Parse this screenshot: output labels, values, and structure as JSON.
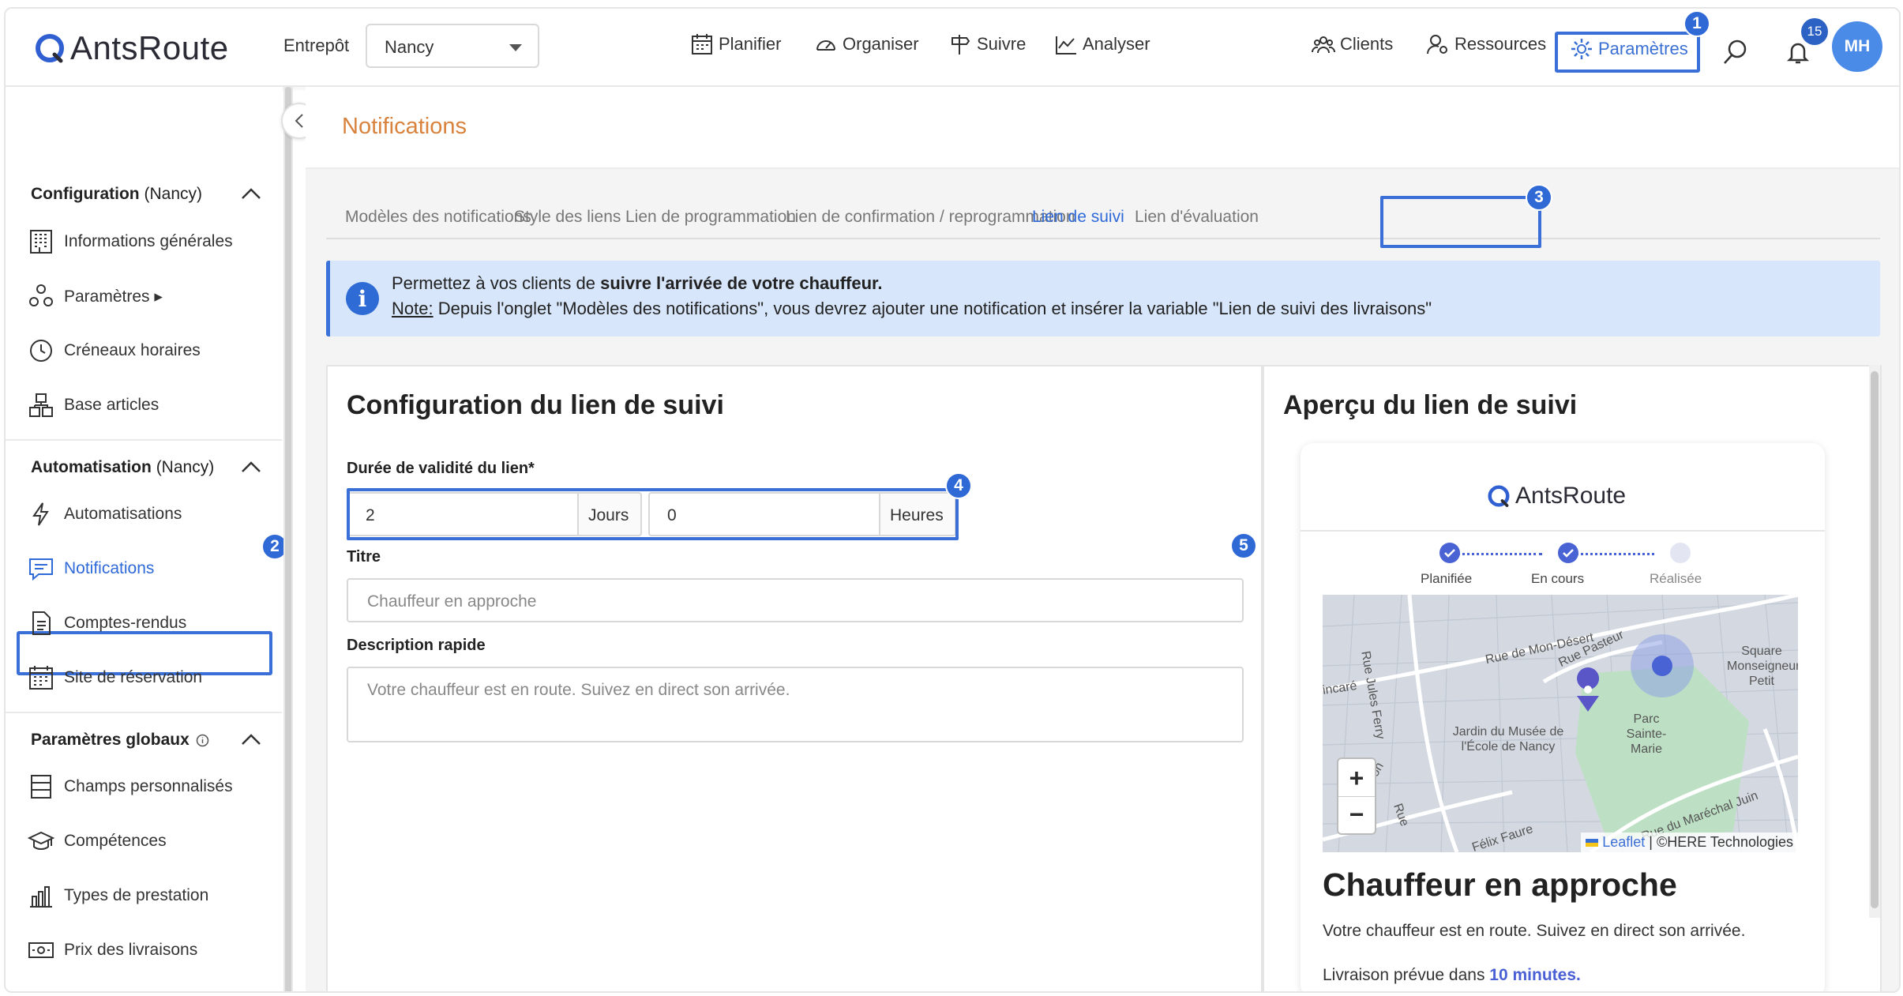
{
  "header": {
    "logo": "AntsRoute",
    "warehouse_label": "Entrepôt",
    "warehouse_value": "Nancy",
    "nav": [
      "Planifier",
      "Organiser",
      "Suivre",
      "Analyser"
    ],
    "right_nav": [
      "Clients",
      "Ressources",
      "Paramètres"
    ],
    "notification_count": "15",
    "avatar_initials": "MH"
  },
  "sidebar": {
    "section1": {
      "title": "Configuration",
      "scope": "(Nancy)"
    },
    "section1_items": [
      "Informations générales",
      "Paramètres ▸",
      "Créneaux horaires",
      "Base articles"
    ],
    "section2": {
      "title": "Automatisation",
      "scope": "(Nancy)"
    },
    "section2_items": [
      "Automatisations",
      "Notifications",
      "Comptes-rendus",
      "Site de réservation"
    ],
    "section3": {
      "title": "Paramètres globaux"
    },
    "section3_items": [
      "Champs personnalisés",
      "Compétences",
      "Types de prestation",
      "Prix des livraisons"
    ],
    "active_item": "Notifications"
  },
  "page": {
    "title": "Notifications",
    "tabs": [
      "Modèles des notifications",
      "Style des liens",
      "Lien de programmation",
      "Lien de confirmation / reprogrammation",
      "Lien de suivi",
      "Lien d'évaluation"
    ],
    "active_tab": "Lien de suivi",
    "info": {
      "line1_prefix": "Permettez à vos clients de ",
      "line1_bold": "suivre l'arrivée de votre chauffeur.",
      "note_label": "Note:",
      "line2": " Depuis l'onglet \"Modèles des notifications\", vous devrez ajouter une notification et insérer la variable \"Lien de suivi des livraisons\""
    }
  },
  "config": {
    "title": "Configuration du lien de suivi",
    "duration_label": "Durée de validité du lien*",
    "days_value": "2",
    "days_unit": "Jours",
    "hours_value": "0",
    "hours_unit": "Heures",
    "titre_label": "Titre",
    "titre_placeholder": "Chauffeur en approche",
    "desc_label": "Description rapide",
    "desc_placeholder": "Votre chauffeur est en route. Suivez en direct son arrivée."
  },
  "preview": {
    "title": "Aperçu du lien de suivi",
    "logo": "AntsRoute",
    "steps": [
      "Planifiée",
      "En cours",
      "Réalisée"
    ],
    "map_labels": [
      "Rue de Mon-Désert",
      "Rue Jules Ferry",
      "Rue Pasteur",
      "Square Monseigneur Petit",
      "Parc Sainte-Marie",
      "Jardin du Musée de l'École de Nancy",
      "incaré",
      "Rue du Maréchal Juin",
      "Rue",
      "Félix Faure",
      "ation"
    ],
    "zoom_in": "+",
    "zoom_out": "−",
    "attribution_link": "Leaflet",
    "attribution_rest": "| ©HERE Technologies",
    "heading": "Chauffeur en approche",
    "description": "Votre chauffeur est en route. Suivez en direct son arrivée.",
    "eta_prefix": "Livraison prévue dans ",
    "eta_value": "10 minutes."
  },
  "annotations": [
    "1",
    "2",
    "3",
    "4",
    "5"
  ],
  "colors": {
    "accent": "#3b6fd8",
    "title_orange": "#d9823c",
    "info_bg": "#d7e6fb"
  }
}
